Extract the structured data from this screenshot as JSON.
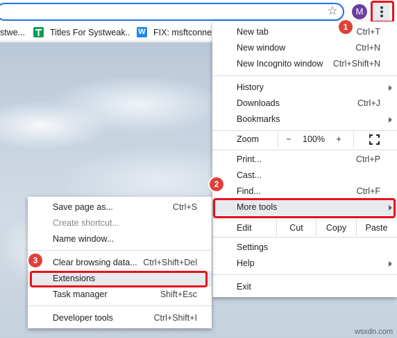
{
  "browser": {
    "avatar_letter": "M",
    "bookmarks": [
      {
        "label": "stwe...",
        "icon": "bookmark-partial",
        "color": ""
      },
      {
        "label": "Titles For Systweak...",
        "icon": "sheets-icon",
        "color": "#0f9d58"
      },
      {
        "label": "FIX: msftconnect...",
        "icon": "w-site-icon",
        "color": "#1e88e5"
      }
    ]
  },
  "main_menu": {
    "items": {
      "new_tab": {
        "label": "New tab",
        "shortcut": "Ctrl+T"
      },
      "new_window": {
        "label": "New window",
        "shortcut": "Ctrl+N"
      },
      "new_incognito": {
        "label": "New Incognito window",
        "shortcut": "Ctrl+Shift+N"
      },
      "history": {
        "label": "History"
      },
      "downloads": {
        "label": "Downloads",
        "shortcut": "Ctrl+J"
      },
      "bookmarks": {
        "label": "Bookmarks"
      },
      "print": {
        "label": "Print...",
        "shortcut": "Ctrl+P"
      },
      "cast": {
        "label": "Cast..."
      },
      "find": {
        "label": "Find...",
        "shortcut": "Ctrl+F"
      },
      "more_tools": {
        "label": "More tools"
      },
      "settings": {
        "label": "Settings"
      },
      "help": {
        "label": "Help"
      },
      "exit": {
        "label": "Exit"
      }
    },
    "zoom": {
      "label": "Zoom",
      "minus": "−",
      "value": "100%",
      "plus": "+"
    },
    "edit": {
      "label": "Edit",
      "cut": "Cut",
      "copy": "Copy",
      "paste": "Paste"
    }
  },
  "more_tools_menu": {
    "items": [
      {
        "label": "Save page as...",
        "shortcut": "Ctrl+S",
        "disabled": false
      },
      {
        "label": "Create shortcut...",
        "shortcut": "",
        "disabled": true
      },
      {
        "label": "Name window...",
        "shortcut": "",
        "disabled": false
      },
      {
        "label": "Clear browsing data...",
        "shortcut": "Ctrl+Shift+Del",
        "disabled": false
      },
      {
        "label": "Extensions",
        "shortcut": "",
        "disabled": false
      },
      {
        "label": "Task manager",
        "shortcut": "Shift+Esc",
        "disabled": false
      },
      {
        "label": "Developer tools",
        "shortcut": "Ctrl+Shift+I",
        "disabled": false
      }
    ]
  },
  "callouts": {
    "step1": "1",
    "step2": "2",
    "step3": "3"
  },
  "highlight_color": "#e8101c",
  "watermark": "wsxdn.com"
}
